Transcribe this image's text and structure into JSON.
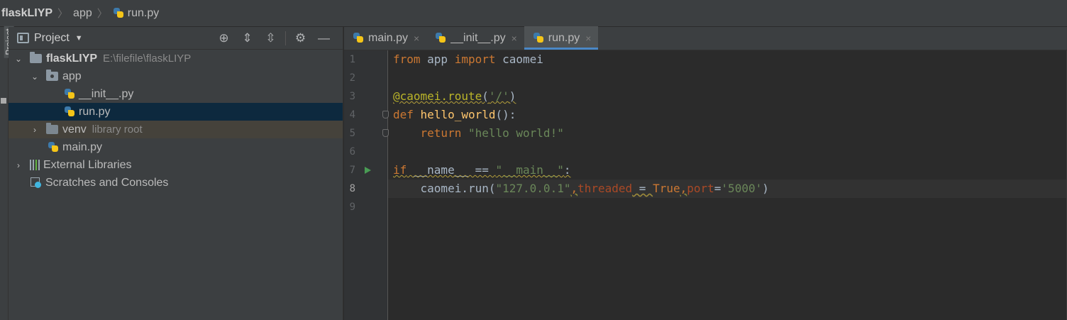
{
  "breadcrumb": {
    "project": "flaskLIYP",
    "folder": "app",
    "file": "run.py"
  },
  "tool_strip": {
    "label": "Project"
  },
  "project_panel": {
    "title": "Project",
    "tools": {
      "locate_icon": "⊕",
      "expand_icon": "⇕",
      "collapse_icon": "⇳",
      "settings_icon": "⚙",
      "hide_icon": "—"
    },
    "tree": {
      "root": {
        "name": "flaskLIYP",
        "path": "E:\\filefile\\flaskLIYP"
      },
      "app": "app",
      "init": "__init__.py",
      "run": "run.py",
      "venv": {
        "name": "venv",
        "hint": "library root"
      },
      "main": "main.py",
      "external": "External Libraries",
      "scratches": "Scratches and Consoles"
    }
  },
  "tabs": [
    {
      "label": "main.py",
      "close": "×"
    },
    {
      "label": "__init__.py",
      "close": "×"
    },
    {
      "label": "run.py",
      "close": "×"
    }
  ],
  "editor": {
    "line_numbers": [
      "1",
      "2",
      "3",
      "4",
      "5",
      "6",
      "7",
      "8",
      "9"
    ],
    "current_line": 8,
    "lines": {
      "l1": {
        "kw1": "from",
        "t1": " app ",
        "kw2": "import",
        "t2": " caomei"
      },
      "l3": {
        "dec": "@caomei.route",
        "p1": "(",
        "s": "'/'",
        "p2": ")"
      },
      "l4": {
        "kw": "def",
        "sp": " ",
        "fn": "hello_world",
        "rest": "():"
      },
      "l5": {
        "indent": "    ",
        "kw": "return",
        "sp": " ",
        "s": "\"hello world!\""
      },
      "l7": {
        "kw": "if",
        "t1": " __name__ == ",
        "s": "\"__main__\"",
        "t2": ":"
      },
      "l8": {
        "indent": "    ",
        "t1": "caomei.run(",
        "s1": "\"127.0.0.1\"",
        "c1": ",",
        "a1": "threaded",
        "t2": " = ",
        "kw": "True",
        "c2": ",",
        "a2": "port",
        "eq": "=",
        "s2": "'5000'",
        "t3": ")"
      }
    }
  },
  "colors": {
    "background": "#2b2b2b",
    "panel": "#3c3f41",
    "selection": "#0d293e",
    "keyword": "#cc7832",
    "string": "#6a8759",
    "function": "#ffc66d",
    "decorator": "#bbb529",
    "accent": "#4a88c7"
  }
}
